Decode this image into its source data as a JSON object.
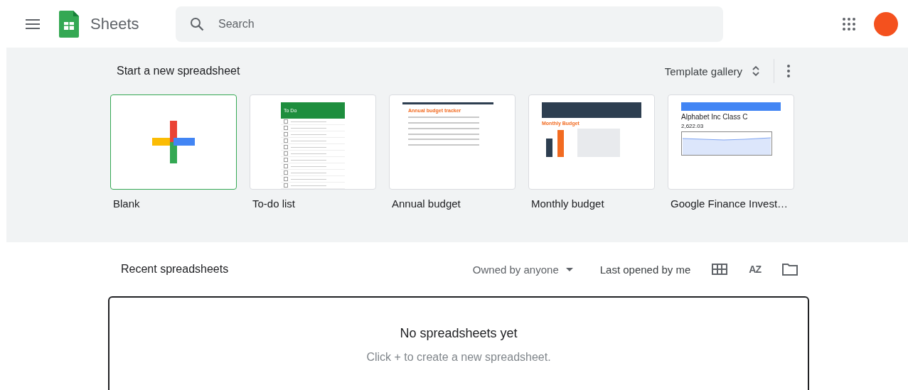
{
  "app": {
    "name": "Sheets"
  },
  "search": {
    "placeholder": "Search"
  },
  "templates_section": {
    "title": "Start a new spreadsheet",
    "gallery_button": "Template gallery"
  },
  "templates": [
    {
      "kind": "blank",
      "label": "Blank",
      "selected": true
    },
    {
      "kind": "todo",
      "label": "To-do list",
      "selected": false,
      "preview_title": "To Do"
    },
    {
      "kind": "annual",
      "label": "Annual budget",
      "selected": false,
      "preview_title": "Annual budget tracker"
    },
    {
      "kind": "monthly",
      "label": "Monthly budget",
      "selected": false,
      "preview_title": "Monthly Budget"
    },
    {
      "kind": "finance",
      "label": "Google Finance Invest…",
      "selected": false,
      "preview_title": "Alphabet Inc Class C",
      "preview_value": "2,622.03"
    }
  ],
  "recent": {
    "title": "Recent spreadsheets",
    "owner_filter": "Owned by anyone",
    "sort": "Last opened by me",
    "sort_icon_text": "AZ"
  },
  "empty_state": {
    "title": "No spreadsheets yet",
    "hint": "Click + to create a new spreadsheet."
  }
}
